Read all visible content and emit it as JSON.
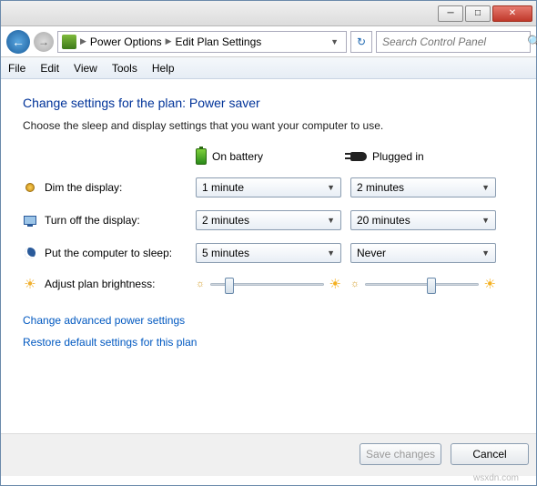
{
  "breadcrumb": {
    "item1": "Power Options",
    "item2": "Edit Plan Settings"
  },
  "search": {
    "placeholder": "Search Control Panel"
  },
  "menu": {
    "file": "File",
    "edit": "Edit",
    "view": "View",
    "tools": "Tools",
    "help": "Help"
  },
  "heading": "Change settings for the plan: Power saver",
  "subtitle": "Choose the sleep and display settings that you want your computer to use.",
  "columns": {
    "battery": "On battery",
    "plugged": "Plugged in"
  },
  "rows": {
    "dim": {
      "label": "Dim the display:",
      "battery": "1 minute",
      "plugged": "2 minutes"
    },
    "off": {
      "label": "Turn off the display:",
      "battery": "2 minutes",
      "plugged": "20 minutes"
    },
    "sleep": {
      "label": "Put the computer to sleep:",
      "battery": "5 minutes",
      "plugged": "Never"
    },
    "bright": {
      "label": "Adjust plan brightness:"
    }
  },
  "sliders": {
    "battery_pct": 12,
    "plugged_pct": 55
  },
  "links": {
    "advanced": "Change advanced power settings",
    "restore": "Restore default settings for this plan"
  },
  "buttons": {
    "save": "Save changes",
    "cancel": "Cancel"
  },
  "watermark": "wsxdn.com"
}
